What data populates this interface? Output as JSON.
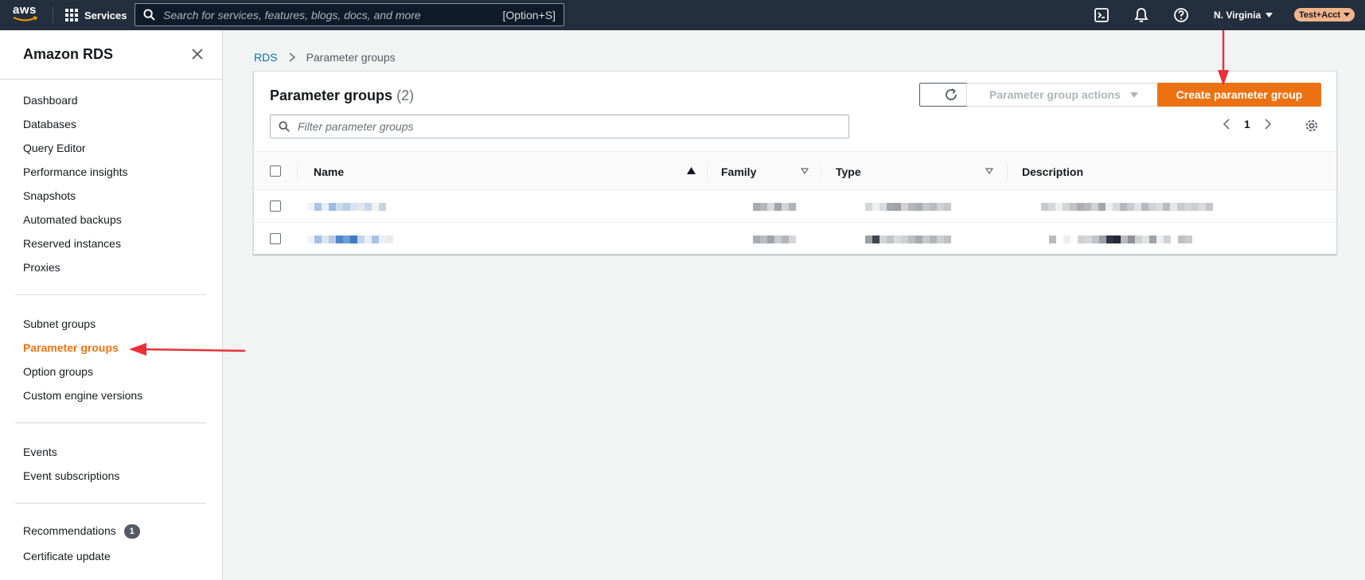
{
  "topnav": {
    "logo_text": "aws",
    "services_label": "Services",
    "search_placeholder": "Search for services, features, blogs, docs, and more",
    "search_shortcut": "[Option+S]",
    "region": "N. Virginia",
    "account": "Test+Acct",
    "icons": [
      "cloudshell-icon",
      "notifications-icon",
      "help-icon"
    ]
  },
  "sidebar": {
    "title": "Amazon RDS",
    "groups": [
      [
        "Dashboard",
        "Databases",
        "Query Editor",
        "Performance insights",
        "Snapshots",
        "Automated backups",
        "Reserved instances",
        "Proxies"
      ],
      [
        "Subnet groups",
        "Parameter groups",
        "Option groups",
        "Custom engine versions"
      ],
      [
        "Events",
        "Event subscriptions"
      ],
      [
        "Recommendations",
        "Certificate update"
      ]
    ],
    "active_item": "Parameter groups",
    "recommendations_badge": "1"
  },
  "breadcrumb": {
    "root": "RDS",
    "current": "Parameter groups"
  },
  "panel": {
    "title": "Parameter groups",
    "count": "(2)",
    "actions_label": "Parameter group actions",
    "create_label": "Create parameter group",
    "filter_placeholder": "Filter parameter groups",
    "page": "1",
    "columns": [
      "Name",
      "Family",
      "Type",
      "Description"
    ],
    "rows": 2
  },
  "colors": {
    "topnav_bg": "#232f3e",
    "accent_orange": "#ec7211",
    "link_blue": "#0073bb",
    "annotation_red": "#e8313a"
  }
}
